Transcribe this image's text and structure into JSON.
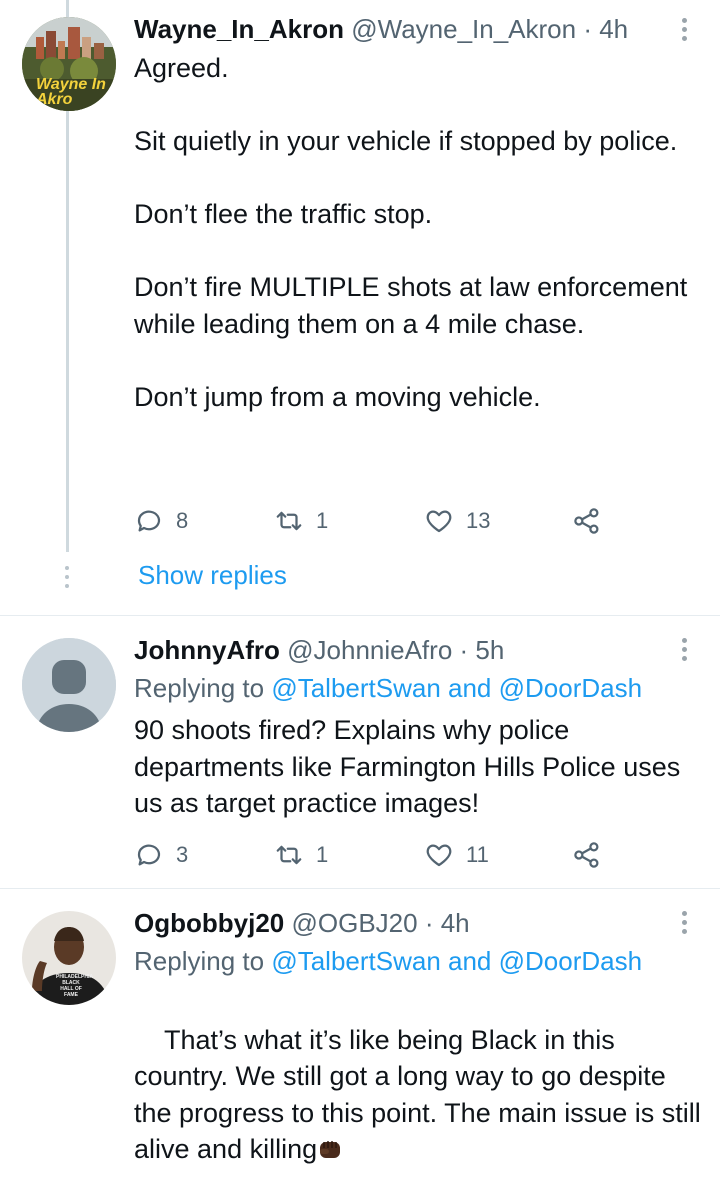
{
  "tweets": [
    {
      "name": "Wayne_In_Akron",
      "handle": "@Wayne_In_Akron",
      "time": "· 4h",
      "avatar_text": "Wayne In Akro",
      "text": "Agreed.\n\nSit quietly in your vehicle if stopped by police.\n\nDon’t flee the traffic stop.\n\nDon’t fire MULTIPLE shots at law enforcement while leading them on a 4 mile chase.\n\nDon’t jump from a moving vehicle.",
      "replies": "8",
      "retweets": "1",
      "likes": "13",
      "show_replies": "Show replies"
    },
    {
      "name": "JohnnyAfro",
      "handle": "@JohnnieAfro",
      "time": "· 5h",
      "replying_prefix": "Replying to",
      "replying_to": "@TalbertSwan and @DoorDash",
      "text": "90 shoots fired? Explains why police departments like Farmington Hills Police uses us as target practice images!",
      "replies": "3",
      "retweets": "1",
      "likes": "11"
    },
    {
      "name": "Ogbobbyj20",
      "handle": "@OGBJ20",
      "time": "· 4h",
      "replying_prefix": "Replying to",
      "replying_to": "@TalbertSwan and @DoorDash",
      "text": "That’s what it’s like being Black in this country. We still got a long way to go despite the progress to this point. The main issue is still alive and killing",
      "shirt_text": "PHILADELPHIA BLACK HALL OF FAME"
    }
  ],
  "colors": {
    "link": "#1d9bf0",
    "secondary_text": "#536471",
    "divider": "#e6ecf0",
    "icon": "#536471"
  },
  "icons": [
    "reply-icon",
    "retweet-icon",
    "like-icon",
    "share-icon",
    "more-icon",
    "fist-emoji"
  ]
}
